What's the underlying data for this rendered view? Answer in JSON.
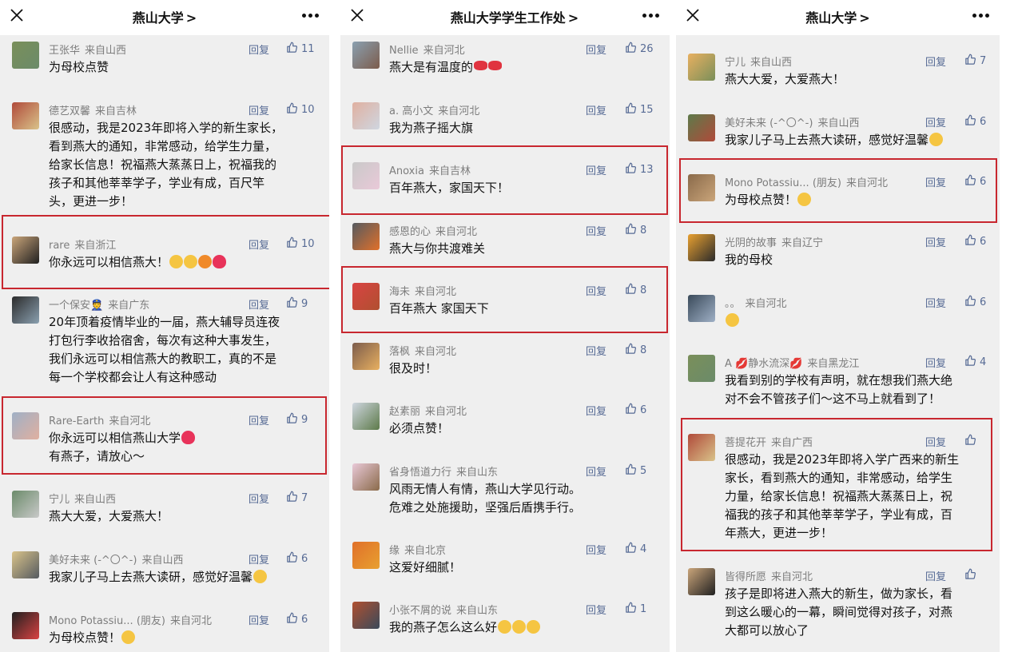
{
  "colors": {
    "accent": "#576b95",
    "highlight": "#c8272f",
    "bg": "#efefef"
  },
  "panels": [
    {
      "title": "燕山大学",
      "chevron": ">",
      "comments": [
        {
          "name": "王张华",
          "loc": "来自山西",
          "reply": "回复",
          "likes": "11",
          "lines": [
            "为母校点赞"
          ],
          "emoji": []
        },
        {
          "name": "德艺双馨",
          "loc": "来自吉林",
          "reply": "回复",
          "likes": "10",
          "lines": [
            "很感动，我是2023年即将入学的新生家长，",
            "看到燕大的通知，非常感动，给学生力量，",
            "给家长信息！祝福燕大蒸蒸日上，祝福我的",
            "孩子和其他莘莘学子，学业有成，百尺竿",
            "头，更进一步！"
          ],
          "emoji": []
        },
        {
          "name": "rare",
          "loc": "来自浙江",
          "reply": "回复",
          "likes": "10",
          "lines": [
            "你永远可以相信燕大！"
          ],
          "emoji": [
            "cry",
            "cry",
            "angry",
            "heart"
          ]
        },
        {
          "name": "一个保安👮",
          "loc": "来自广东",
          "reply": "回复",
          "likes": "9",
          "lines": [
            "20年顶着疫情毕业的一届，燕大辅导员连夜",
            "打包行李收拾宿舍，每次有这种大事发生，",
            "我们永远可以相信燕大的教职工，真的不是",
            "每一个学校都会让人有这种感动"
          ],
          "emoji": []
        },
        {
          "name": "Rare-Earth",
          "loc": "来自河北",
          "reply": "回复",
          "likes": "9",
          "lines": [
            "你永远可以相信燕山大学",
            "有燕子，请放心～"
          ],
          "emoji": [
            "heart"
          ]
        },
        {
          "name": "宁儿",
          "loc": "来自山西",
          "reply": "回复",
          "likes": "7",
          "lines": [
            "燕大大爱，大爱燕大！"
          ],
          "emoji": []
        },
        {
          "name": "美好未来 (-^〇^-)",
          "loc": "来自山西",
          "reply": "回复",
          "likes": "6",
          "lines": [
            "我家儿子马上去燕大读研，感觉好温馨"
          ],
          "emoji": [
            "thumb"
          ]
        },
        {
          "name": "Mono Potassiu... (朋友)",
          "loc": "来自河北",
          "reply": "回复",
          "likes": "6",
          "lines": [
            "为母校点赞！"
          ],
          "emoji": [
            "thumb"
          ]
        }
      ]
    },
    {
      "title": "燕山大学学生工作处",
      "chevron": ">",
      "comments": [
        {
          "name": "Nellie",
          "loc": "来自河北",
          "reply": "回复",
          "likes": "26",
          "lines": [
            "燕大是有温度的"
          ],
          "emoji": [
            "lips",
            "lips"
          ]
        },
        {
          "name": "a. 高小文",
          "loc": "来自河北",
          "reply": "回复",
          "likes": "15",
          "lines": [
            "我为燕子摇大旗"
          ],
          "emoji": []
        },
        {
          "name": "Anoxia",
          "loc": "来自吉林",
          "reply": "回复",
          "likes": "13",
          "lines": [
            "百年燕大，家国天下！"
          ],
          "emoji": []
        },
        {
          "name": "感恩的心",
          "loc": "来自河北",
          "reply": "回复",
          "likes": "8",
          "lines": [
            "燕大与你共渡难关"
          ],
          "emoji": []
        },
        {
          "name": "海未",
          "loc": "来自河北",
          "reply": "回复",
          "likes": "8",
          "lines": [
            "百年燕大 家国天下"
          ],
          "emoji": []
        },
        {
          "name": "落枫",
          "loc": "来自河北",
          "reply": "回复",
          "likes": "8",
          "lines": [
            "很及时！"
          ],
          "emoji": []
        },
        {
          "name": "赵素丽",
          "loc": "来自河北",
          "reply": "回复",
          "likes": "6",
          "lines": [
            "必须点赞！"
          ],
          "emoji": []
        },
        {
          "name": "省身悟道力行",
          "loc": "来自山东",
          "reply": "回复",
          "likes": "5",
          "lines": [
            "风雨无情人有情，燕山大学见行动。",
            "危难之处施援助，坚强后盾携手行。"
          ],
          "emoji": []
        },
        {
          "name": "缘",
          "loc": "来自北京",
          "reply": "回复",
          "likes": "4",
          "lines": [
            "这爱好细腻！"
          ],
          "emoji": []
        },
        {
          "name": "小张不屑的说",
          "loc": "来自山东",
          "reply": "回复",
          "likes": "1",
          "lines": [
            "我的燕子怎么这么好"
          ],
          "emoji": [
            "cry",
            "cry",
            "cry"
          ]
        }
      ]
    },
    {
      "title": "燕山大学",
      "chevron": ">",
      "comments": [
        {
          "name": "宁儿",
          "loc": "来自山西",
          "reply": "回复",
          "likes": "7",
          "lines": [
            "燕大大爱，大爱燕大！"
          ],
          "emoji": []
        },
        {
          "name": "美好未来 (-^〇^-)",
          "loc": "来自山西",
          "reply": "回复",
          "likes": "6",
          "lines": [
            "我家儿子马上去燕大读研，感觉好温馨"
          ],
          "emoji": [
            "thumb"
          ]
        },
        {
          "name": "Mono Potassiu... (朋友)",
          "loc": "来自河北",
          "reply": "回复",
          "likes": "6",
          "lines": [
            "为母校点赞！"
          ],
          "emoji": [
            "thumb"
          ]
        },
        {
          "name": "光阴的故事",
          "loc": "来自辽宁",
          "reply": "回复",
          "likes": "6",
          "lines": [
            "我的母校"
          ],
          "emoji": []
        },
        {
          "name": "。。",
          "loc": "来自河北",
          "reply": "回复",
          "likes": "6",
          "lines": [
            ""
          ],
          "emoji": [
            "thumb"
          ]
        },
        {
          "name": "A 💋静水流深💋",
          "loc": "来自黑龙江",
          "reply": "回复",
          "likes": "4",
          "lines": [
            "我看到别的学校有声明，就在想我们燕大绝",
            "对不会不管孩子们～这不马上就看到了！"
          ],
          "emoji": []
        },
        {
          "name": "菩提花开",
          "loc": "来自广西",
          "reply": "回复",
          "likes": "",
          "lines": [
            "很感动，我是2023年即将入学广西来的新生",
            "家长，看到燕大的通知，非常感动，给学生",
            "力量，给家长信息！祝福燕大蒸蒸日上，祝",
            "福我的孩子和其他莘莘学子，学业有成，百",
            "年燕大，更进一步！"
          ],
          "emoji": []
        },
        {
          "name": "皆得所愿",
          "loc": "来自河北",
          "reply": "回复",
          "likes": "",
          "lines": [
            "孩子是即将进入燕大的新生，做为家长，看",
            "到这么暖心的一幕，瞬间觉得对孩子，对燕",
            "大都可以放心了"
          ],
          "emoji": []
        }
      ]
    }
  ]
}
